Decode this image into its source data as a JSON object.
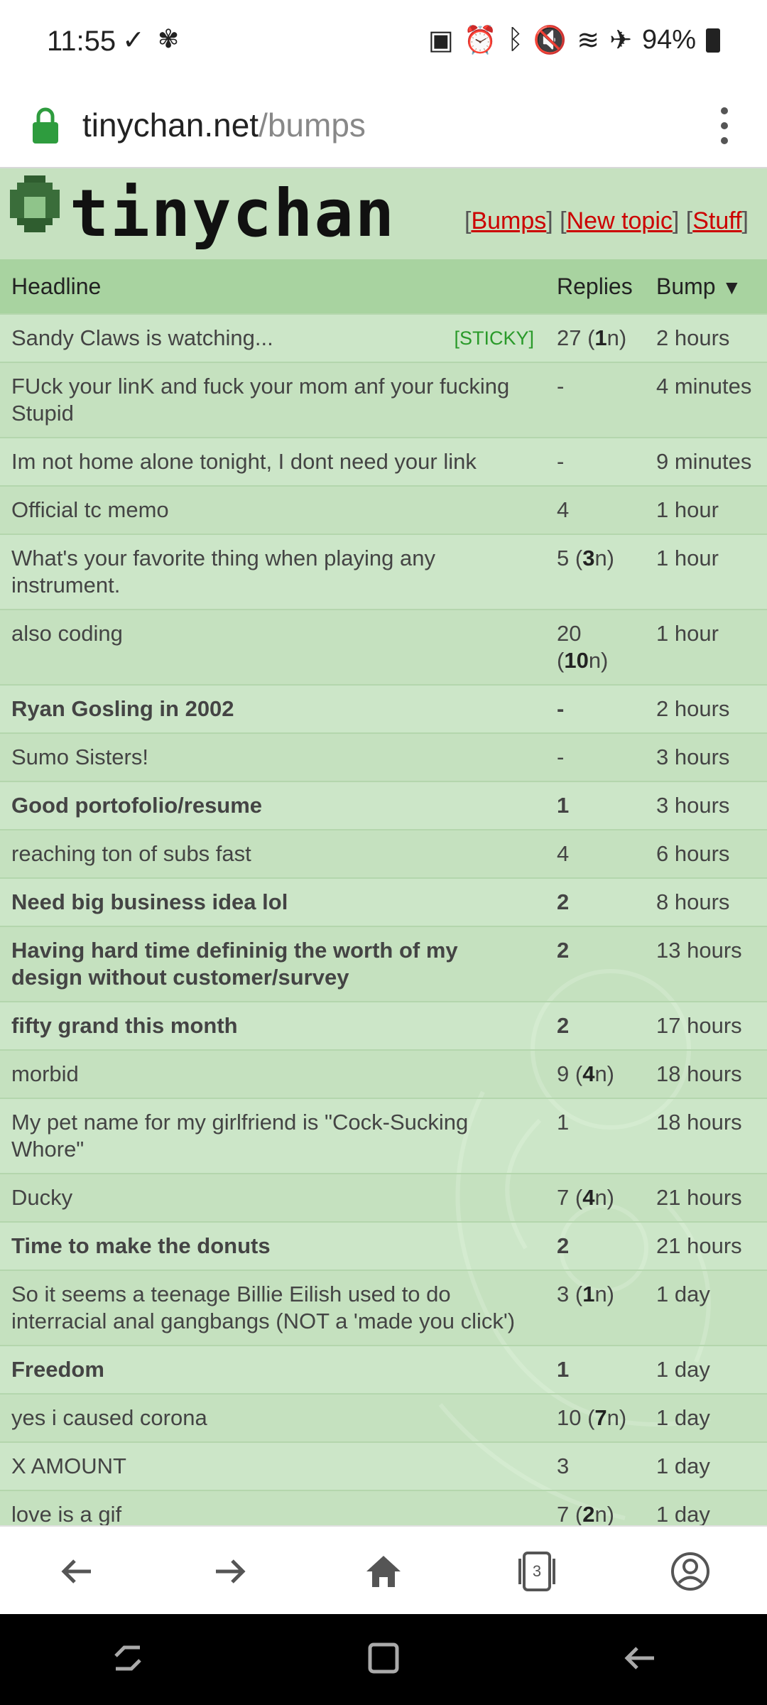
{
  "status": {
    "time": "11:55",
    "battery": "94%"
  },
  "browser": {
    "url_domain": "tinychan.net",
    "url_path": "/bumps",
    "tab_count": "3"
  },
  "site": {
    "logo_text": "tinychan",
    "links": {
      "bumps": "Bumps",
      "new_topic": "New topic",
      "stuff": "Stuff"
    }
  },
  "table": {
    "headers": {
      "headline": "Headline",
      "replies": "Replies",
      "bump": "Bump"
    },
    "rows": [
      {
        "headline": "Sandy Claws is watching...",
        "bold": false,
        "sticky": "[STICKY]",
        "replies": "27",
        "new": "1",
        "bump": "2 hours"
      },
      {
        "headline": "FUck your linK and fuck your mom anf your fucking Stupid",
        "bold": false,
        "replies": "-",
        "bump": "4 minutes"
      },
      {
        "headline": "Im not home alone tonight, I dont need your link",
        "bold": false,
        "replies": "-",
        "bump": "9 minutes"
      },
      {
        "headline": "Official tc memo",
        "bold": false,
        "replies": "4",
        "bump": "1 hour"
      },
      {
        "headline": "What's your favorite thing when playing any instrument.",
        "bold": false,
        "replies": "5",
        "new": "3",
        "bump": "1 hour"
      },
      {
        "headline": "also coding",
        "bold": false,
        "replies": "20",
        "new": "10",
        "bump": "1 hour"
      },
      {
        "headline": "Ryan Gosling in 2002",
        "bold": true,
        "replies": "-",
        "bump": "2 hours"
      },
      {
        "headline": "Sumo Sisters!",
        "bold": false,
        "replies": "-",
        "bump": "3 hours"
      },
      {
        "headline": "Good portofolio/resume",
        "bold": true,
        "replies": "1",
        "bump": "3 hours"
      },
      {
        "headline": "reaching ton of subs fast",
        "bold": false,
        "replies": "4",
        "bump": "6 hours"
      },
      {
        "headline": "Need big business idea lol",
        "bold": true,
        "replies": "2",
        "bump": "8 hours"
      },
      {
        "headline": "Having hard time defininig the worth of my design without customer/survey",
        "bold": true,
        "replies": "2",
        "bump": "13 hours"
      },
      {
        "headline": "fifty grand this month",
        "bold": true,
        "replies": "2",
        "bump": "17 hours"
      },
      {
        "headline": "morbid",
        "bold": false,
        "replies": "9",
        "new": "4",
        "bump": "18 hours"
      },
      {
        "headline": "My pet name for my girlfriend is \"Cock-Sucking Whore\"",
        "bold": false,
        "replies": "1",
        "bump": "18 hours"
      },
      {
        "headline": "Ducky",
        "bold": false,
        "replies": "7",
        "new": "4",
        "bump": "21 hours"
      },
      {
        "headline": "Time to make the donuts",
        "bold": true,
        "replies": "2",
        "bump": "21 hours"
      },
      {
        "headline": "So it seems a teenage Billie Eilish used to do interracial anal gangbangs (NOT a 'made you click')",
        "bold": false,
        "replies": "3",
        "new": "1",
        "bump": "1 day"
      },
      {
        "headline": "Freedom",
        "bold": true,
        "replies": "1",
        "bump": "1 day"
      },
      {
        "headline": "yes i caused corona",
        "bold": false,
        "replies": "10",
        "new": "7",
        "bump": "1 day"
      },
      {
        "headline": "X AMOUNT",
        "bold": false,
        "replies": "3",
        "bump": "1 day"
      },
      {
        "headline": "love is a gif",
        "bold": false,
        "replies": "7",
        "new": "2",
        "bump": "1 day"
      }
    ]
  }
}
